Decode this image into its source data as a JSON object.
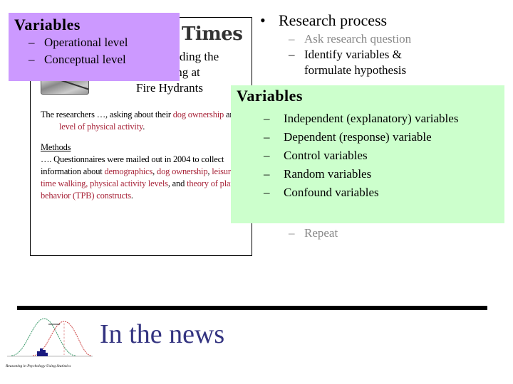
{
  "clipping": {
    "masthead": "Times",
    "headline_lines": [
      "…understanding the",
      "…topping at",
      "Fire Hydrants"
    ],
    "paragraph1": {
      "prefix": "The researchers …, asking about their ",
      "term1": "dog ownership",
      "mid": " and ",
      "term2": "level of physical activity",
      "suffix": "."
    },
    "methods_heading": "Methods",
    "paragraph2": {
      "prefix": "…. Questionnaires were mailed out in 2004 to collect information about ",
      "term1": "demographics",
      "sep1": ", ",
      "term2": "dog ownership",
      "sep2": ", ",
      "term3": "leisure-time walking, physical activity levels",
      "mid": ", and ",
      "term4": "theory of planned behavior (TPB) constructs",
      "suffix": "."
    }
  },
  "purple_box": {
    "title": "Variables",
    "items": [
      "Operational level",
      "Conceptual level"
    ]
  },
  "research_process": {
    "bullet": "Research process",
    "items": [
      {
        "text": "Ask research question",
        "dimmed": true
      },
      {
        "text": "Identify variables &",
        "dimmed": false
      },
      {
        "text": "formulate hypothesis",
        "dimmed": false
      }
    ],
    "repeat": "Repeat"
  },
  "green_box": {
    "title": "Variables",
    "items": [
      "Independent (explanatory) variables",
      "Dependent (response) variable",
      "Control variables",
      "Random variables",
      "Confound variables"
    ]
  },
  "footer": {
    "title": "In the news",
    "logo_caption": "Reasoning in Psychology Using Statistics"
  },
  "colors": {
    "purple": "#cc99ff",
    "green": "#ccffcc",
    "highlight_red": "#a8253a",
    "title_blue": "#333380",
    "dim_grey": "#888888"
  },
  "dash": "–",
  "bullet_glyph": "•"
}
